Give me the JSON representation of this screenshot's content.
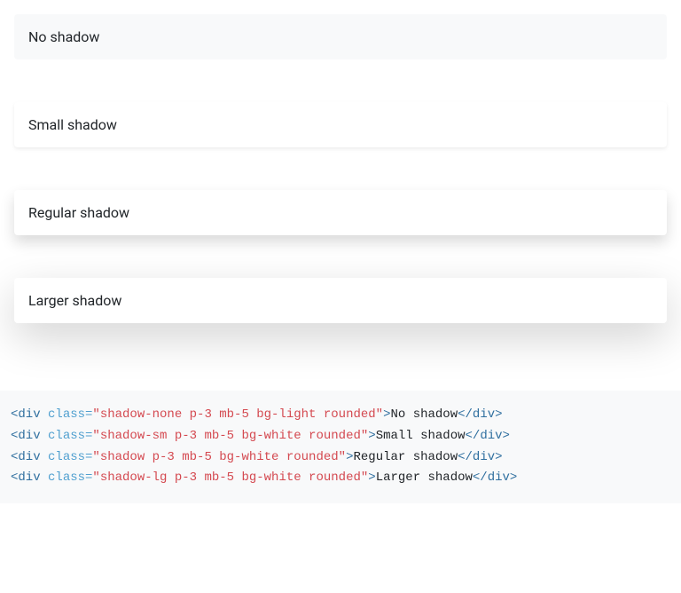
{
  "demo": {
    "items": [
      {
        "label": "No shadow",
        "classes": "shadow-none p-3 mb-5 bg-light rounded"
      },
      {
        "label": "Small shadow",
        "classes": "shadow-sm p-3 mb-5 bg-white rounded"
      },
      {
        "label": "Regular shadow",
        "classes": "shadow p-3 mb-5 bg-white rounded"
      },
      {
        "label": "Larger shadow",
        "classes": "shadow-lg p-3 mb-5 bg-white rounded"
      }
    ]
  },
  "code": {
    "lines": [
      {
        "tag_open": "<div",
        "attr_name": " class=",
        "attr_value": "\"shadow-none p-3 mb-5 bg-light rounded\"",
        "gt": ">",
        "text": "No shadow",
        "tag_close": "</div>"
      },
      {
        "tag_open": "<div",
        "attr_name": " class=",
        "attr_value": "\"shadow-sm p-3 mb-5 bg-white rounded\"",
        "gt": ">",
        "text": "Small shadow",
        "tag_close": "</div>"
      },
      {
        "tag_open": "<div",
        "attr_name": " class=",
        "attr_value": "\"shadow p-3 mb-5 bg-white rounded\"",
        "gt": ">",
        "text": "Regular shadow",
        "tag_close": "</div>"
      },
      {
        "tag_open": "<div",
        "attr_name": " class=",
        "attr_value": "\"shadow-lg p-3 mb-5 bg-white rounded\"",
        "gt": ">",
        "text": "Larger shadow",
        "tag_close": "</div>"
      }
    ]
  }
}
